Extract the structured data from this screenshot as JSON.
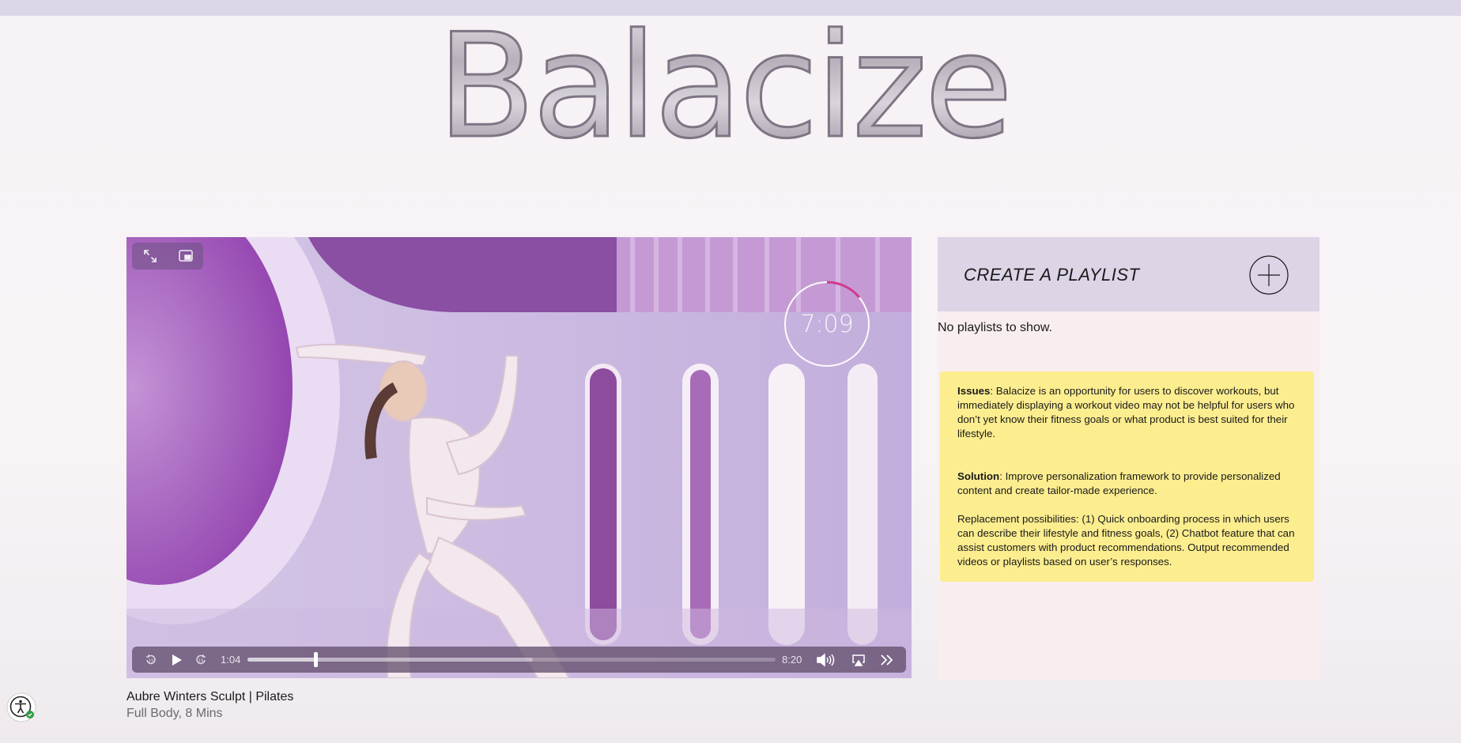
{
  "brand": {
    "logo_text": "Balacize"
  },
  "player": {
    "timer_display": "7:09",
    "timer_progress": 0.14,
    "current_time": "1:04",
    "duration": "8:20",
    "progress": 0.128,
    "buffered": 0.54,
    "icons": {
      "fullscreen": "expand-arrows-icon",
      "pip": "picture-in-picture-icon",
      "skip_back": "rewind-15-icon",
      "play": "play-icon",
      "skip_forward": "forward-15-icon",
      "volume": "volume-icon",
      "airplay": "airplay-icon",
      "more": "chevron-double-right-icon"
    }
  },
  "video": {
    "title": "Aubre Winters Sculpt | Pilates",
    "subtitle": "Full Body, 8 Mins"
  },
  "playlist": {
    "header": "CREATE A PLAYLIST",
    "empty_text": "No playlists to show."
  },
  "note": {
    "issues_label": "Issues",
    "issues_text": ": Balacize is an opportunity for users to discover workouts, but immediately displaying a workout video may not be helpful for users who don’t yet know their fitness goals or what product is best suited for their lifestyle.",
    "solution_label": "Solution",
    "solution_text": ": Improve personalization framework to provide personalized content and create tailor-made experience.",
    "replacement_text": "Replacement possibilities: (1) Quick onboarding process in which users can describe their lifestyle and fitness goals, (2) Chatbot feature that can assist customers with product recommendations. Output recommended videos or playlists based on user’s responses."
  },
  "colors": {
    "page_bg": "#f6f2f5",
    "top_strip": "#ddd6e8",
    "playlist_header_bg": "#ddd4e6",
    "panel_bg": "#f9eeef",
    "note_bg": "#fced8f",
    "timer_accent": "#d13a8e"
  },
  "accessibility": {
    "icon": "accessibility-person-icon"
  }
}
